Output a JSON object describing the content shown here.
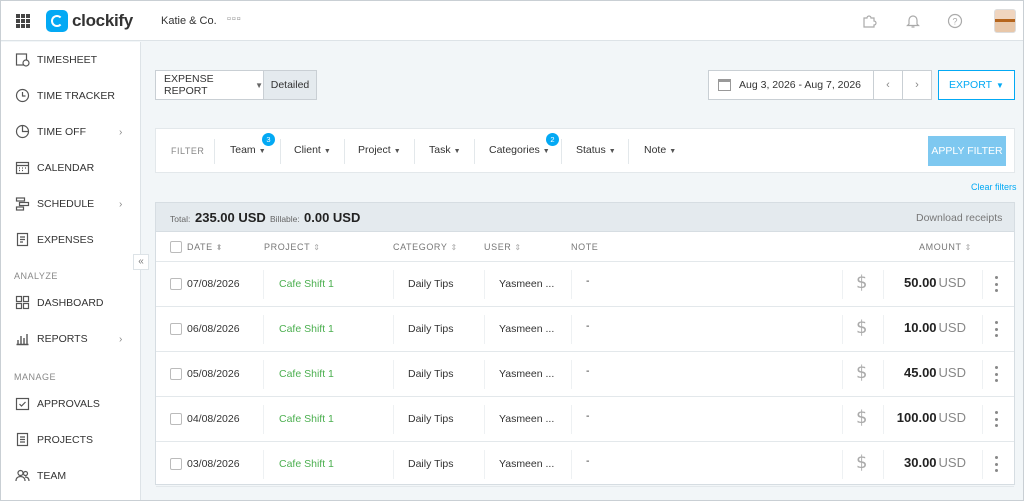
{
  "header": {
    "logo_text": "clockify",
    "workspace": "Katie & Co.",
    "icons": [
      "apps-grid-icon",
      "puzzle-icon",
      "bell-icon",
      "help-icon",
      "user-avatar"
    ]
  },
  "sidebar": {
    "items": [
      {
        "label": "TIMESHEET",
        "icon": "timesheet-icon"
      },
      {
        "label": "TIME TRACKER",
        "icon": "clock-icon"
      },
      {
        "label": "TIME OFF",
        "icon": "time-off-icon"
      },
      {
        "label": "CALENDAR",
        "icon": "calendar-icon"
      },
      {
        "label": "SCHEDULE",
        "icon": "schedule-icon"
      },
      {
        "label": "EXPENSES",
        "icon": "expenses-icon"
      }
    ],
    "analyze_label": "ANALYZE",
    "analyze_items": [
      {
        "label": "DASHBOARD",
        "icon": "dashboard-icon"
      },
      {
        "label": "REPORTS",
        "icon": "reports-icon"
      }
    ],
    "manage_label": "MANAGE",
    "manage_items": [
      {
        "label": "APPROVALS",
        "icon": "approvals-icon"
      },
      {
        "label": "PROJECTS",
        "icon": "projects-icon"
      },
      {
        "label": "TEAM",
        "icon": "team-icon"
      }
    ]
  },
  "toolbar": {
    "report_type": "EXPENSE REPORT",
    "view": "Detailed",
    "date_range": "Aug 3, 2026 - Aug 7, 2026",
    "export_label": "EXPORT"
  },
  "filters": {
    "label": "FILTER",
    "items": [
      {
        "label": "Team",
        "badge": "3"
      },
      {
        "label": "Client",
        "badge": ""
      },
      {
        "label": "Project",
        "badge": ""
      },
      {
        "label": "Task",
        "badge": ""
      },
      {
        "label": "Categories",
        "badge": "2"
      },
      {
        "label": "Status",
        "badge": ""
      },
      {
        "label": "Note",
        "badge": ""
      }
    ],
    "apply_label": "APPLY FILTER",
    "clear_label": "Clear filters"
  },
  "summary": {
    "total_label": "Total:",
    "total_value": "235.00 USD",
    "billable_label": "Billable:",
    "billable_value": "0.00 USD",
    "download_label": "Download receipts"
  },
  "table": {
    "columns": {
      "date": "DATE",
      "project": "PROJECT",
      "category": "CATEGORY",
      "user": "USER",
      "note": "NOTE",
      "amount": "AMOUNT"
    },
    "rows": [
      {
        "date": "07/08/2026",
        "project": "Cafe Shift 1",
        "category": "Daily Tips",
        "user": "Yasmeen ...",
        "note": "-",
        "amount": "50.00",
        "currency": "USD"
      },
      {
        "date": "06/08/2026",
        "project": "Cafe Shift 1",
        "category": "Daily Tips",
        "user": "Yasmeen ...",
        "note": "-",
        "amount": "10.00",
        "currency": "USD"
      },
      {
        "date": "05/08/2026",
        "project": "Cafe Shift 1",
        "category": "Daily Tips",
        "user": "Yasmeen ...",
        "note": "-",
        "amount": "45.00",
        "currency": "USD"
      },
      {
        "date": "04/08/2026",
        "project": "Cafe Shift 1",
        "category": "Daily Tips",
        "user": "Yasmeen ...",
        "note": "-",
        "amount": "100.00",
        "currency": "USD"
      },
      {
        "date": "03/08/2026",
        "project": "Cafe Shift 1",
        "category": "Daily Tips",
        "user": "Yasmeen ...",
        "note": "-",
        "amount": "30.00",
        "currency": "USD"
      }
    ]
  },
  "colors": {
    "accent": "#03a9f4",
    "project": "#4caf50",
    "apply_button": "#7ec8f0"
  }
}
